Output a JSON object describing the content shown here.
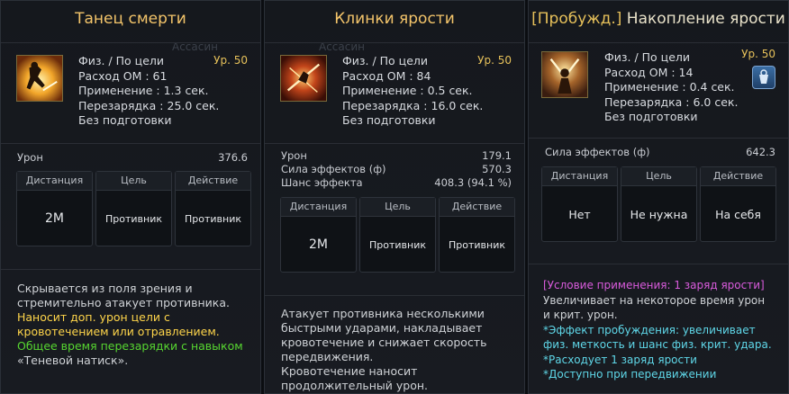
{
  "cards": [
    {
      "title": "Танец смерти",
      "level": "Ур. 50",
      "info": [
        "Физ. / По цели",
        "Расход ОМ : 61",
        "Применение : 1.3 сек.",
        "Перезарядка : 25.0 сек.",
        "Без подготовки"
      ],
      "stats": [
        {
          "label": "Урон",
          "value": "376.6"
        }
      ],
      "table": [
        {
          "header": "Дистанция",
          "value": "2М"
        },
        {
          "header": "Цель",
          "value": "Противник"
        },
        {
          "header": "Действие",
          "value": "Противник"
        }
      ],
      "desc": [
        {
          "text": "Скрывается из поля зрения и",
          "color": "normal"
        },
        {
          "text": "стремительно атакует противника.",
          "color": "normal"
        },
        {
          "text": "Наносит доп. урон цели с",
          "color": "yellow"
        },
        {
          "text": "кровотечением или отравлением.",
          "color": "yellow"
        },
        {
          "text": "Общее время перезарядки с навыком",
          "color": "green"
        },
        {
          "text": "«Теневой натиск».",
          "color": "normal"
        }
      ],
      "ghost": "Ассасин"
    },
    {
      "title": "Клинки ярости",
      "level": "Ур. 50",
      "info": [
        "Физ. / По цели",
        "Расход ОМ : 84",
        "Применение : 0.5 сек.",
        "Перезарядка : 16.0 сек.",
        "Без подготовки"
      ],
      "stats": [
        {
          "label": "Урон",
          "value": "179.1"
        },
        {
          "label": "Сила эффектов (ф)",
          "value": "570.3"
        },
        {
          "label": "Шанс эффекта",
          "value": "408.3 (94.1 %)"
        }
      ],
      "table": [
        {
          "header": "Дистанция",
          "value": "2М"
        },
        {
          "header": "Цель",
          "value": "Противник"
        },
        {
          "header": "Действие",
          "value": "Противник"
        }
      ],
      "desc": [
        {
          "text": "Атакует противника несколькими",
          "color": "normal"
        },
        {
          "text": "быстрыми ударами, накладывает",
          "color": "normal"
        },
        {
          "text": "кровотечение и снижает скорость",
          "color": "normal"
        },
        {
          "text": "передвижения.",
          "color": "normal"
        },
        {
          "text": "Кровотечение наносит",
          "color": "normal"
        },
        {
          "text": "продолжительный урон.",
          "color": "normal"
        }
      ],
      "ghost": "Ассасин"
    },
    {
      "title_prefix": "[Пробужд.]",
      "title": "Накопление ярости",
      "level": "Ур. 50",
      "info": [
        "Физ. / По цели",
        "Расход ОМ : 14",
        "Применение : 0.4 сек.",
        "Перезарядка : 6.0 сек.",
        "Без подготовки"
      ],
      "stats": [
        {
          "label": "Сила эффектов (ф)",
          "value": "642.3"
        }
      ],
      "table": [
        {
          "header": "Дистанция",
          "value": "Нет"
        },
        {
          "header": "Цель",
          "value": "Не нужна"
        },
        {
          "header": "Действие",
          "value": "На себя"
        }
      ],
      "desc": [
        {
          "text": "[Условие применения: 1 заряд ярости]",
          "color": "magenta"
        },
        {
          "text": "Увеличивает на некоторое время урон",
          "color": "normal"
        },
        {
          "text": "и крит. урон.",
          "color": "normal"
        },
        {
          "text": "*Эффект пробуждения: увеличивает",
          "color": "cyan"
        },
        {
          "text": "физ. меткость и шанс физ. крит. удара.",
          "color": "cyan"
        },
        {
          "text": "*Расходует 1 заряд ярости",
          "color": "cyan"
        },
        {
          "text": "*Доступно при передвижении",
          "color": "cyan"
        }
      ]
    }
  ]
}
